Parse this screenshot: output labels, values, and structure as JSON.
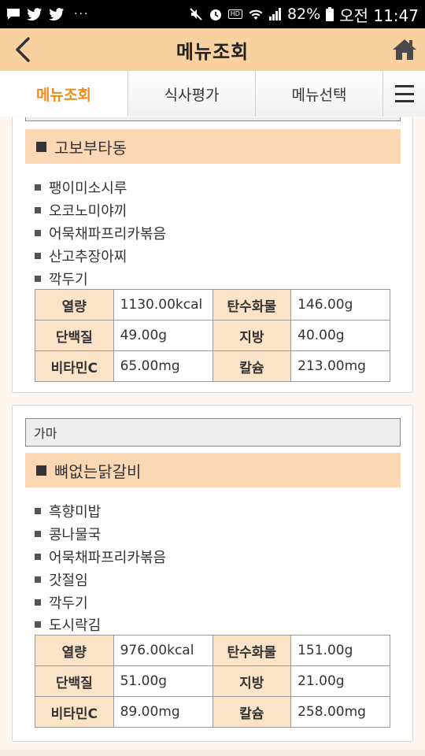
{
  "status_bar": {
    "left_icons": [
      "message-icon",
      "twitter-icon",
      "twitter-icon"
    ],
    "more": "···",
    "hd_label": "HD",
    "battery": "82%",
    "time": "오전 11:47"
  },
  "header": {
    "title": "메뉴조회"
  },
  "tabs": [
    {
      "label": "메뉴조회",
      "active": true
    },
    {
      "label": "식사평가",
      "active": false
    },
    {
      "label": "메뉴선택",
      "active": false
    }
  ],
  "cards": [
    {
      "restaurant": "",
      "main_dish": "고보부타동",
      "sides": [
        "팽이미소시루",
        "오코노미야끼",
        "어묵채파프리카볶음",
        "산고추장아찌",
        "깍두기"
      ],
      "nutrition": [
        {
          "l1": "열량",
          "v1": "1130.00kcal",
          "l2": "탄수화물",
          "v2": "146.00g"
        },
        {
          "l1": "단백질",
          "v1": "49.00g",
          "l2": "지방",
          "v2": "40.00g"
        },
        {
          "l1": "비타민C",
          "v1": "65.00mg",
          "l2": "칼슘",
          "v2": "213.00mg"
        }
      ]
    },
    {
      "restaurant": "가마",
      "main_dish": "뼈없는닭갈비",
      "sides": [
        "흑향미밥",
        "콩나물국",
        "어묵채파프리카볶음",
        "갓절임",
        "깍두기",
        "도시락김"
      ],
      "nutrition": [
        {
          "l1": "열량",
          "v1": "976.00kcal",
          "l2": "탄수화물",
          "v2": "151.00g"
        },
        {
          "l1": "단백질",
          "v1": "51.00g",
          "l2": "지방",
          "v2": "21.00g"
        },
        {
          "l1": "비타민C",
          "v1": "89.00mg",
          "l2": "칼슘",
          "v2": "258.00mg"
        }
      ]
    }
  ],
  "colors": {
    "header_bg": "#f9d09f",
    "active_tab": "#f08a1c",
    "dish_bg": "#fbd7b4",
    "label_bg": "#fbe3c8"
  }
}
